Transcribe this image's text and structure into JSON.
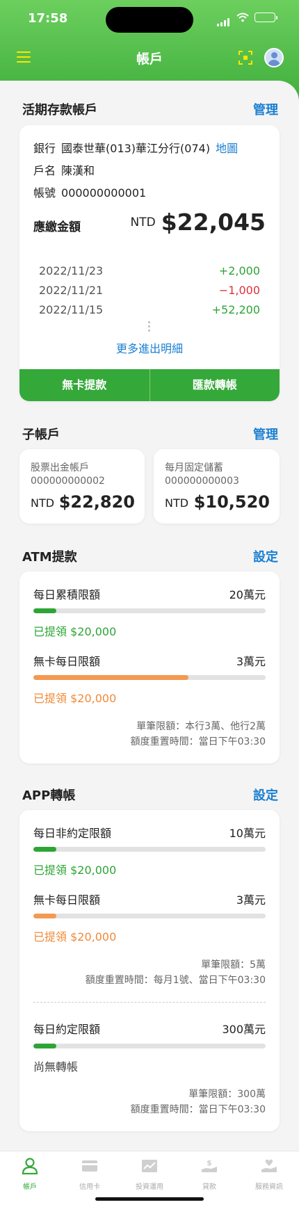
{
  "status_bar": {
    "time": "17:58"
  },
  "nav": {
    "title": "帳戶"
  },
  "savings": {
    "section_title": "活期存款帳戶",
    "manage": "管理",
    "bank_label": "銀行",
    "bank_value": "國泰世華(013)華江分行(074)",
    "map_link": "地圖",
    "name_label": "戶名",
    "name_value": "陳漢和",
    "account_label": "帳號",
    "account_value": "000000000001",
    "amount_label": "應繳金額",
    "currency": "NTD",
    "amount": "$22,045",
    "transactions": [
      {
        "date": "2022/11/23",
        "amount": "+2,000"
      },
      {
        "date": "2022/11/21",
        "amount": "−1,000"
      },
      {
        "date": "2022/11/15",
        "amount": "+52,200"
      }
    ],
    "more_link": "更多進出明細",
    "btn_cardless": "無卡提款",
    "btn_transfer": "匯款轉帳"
  },
  "sub_accounts": {
    "section_title": "子帳戶",
    "manage": "管理",
    "items": [
      {
        "label": "股票出金帳戶",
        "account": "000000000002",
        "currency": "NTD",
        "amount": "$22,820"
      },
      {
        "label": "每月固定儲蓄",
        "account": "000000000003",
        "currency": "NTD",
        "amount": "$10,520"
      }
    ]
  },
  "atm": {
    "section_title": "ATM提款",
    "settings": "設定",
    "limits": [
      {
        "name": "每日累積限額",
        "value": "20萬元",
        "used": "已提領 $20,000",
        "progress": 0.1,
        "color": "#2ca536"
      },
      {
        "name": "無卡每日限額",
        "value": "3萬元",
        "used": "已提領 $20,000",
        "progress": 0.667,
        "color": "#f39a52"
      }
    ],
    "note1": "單筆限額：本行3萬、他行2萬",
    "note2": "額度重置時間：當日下午03:30"
  },
  "app_transfer": {
    "section_title": "APP轉帳",
    "settings": "設定",
    "limits": [
      {
        "name": "每日非約定限額",
        "value": "10萬元",
        "used": "已提領 $20,000",
        "progress": 0.1,
        "color": "#2ca536"
      },
      {
        "name": "無卡每日限額",
        "value": "3萬元",
        "used": "已提領 $20,000",
        "progress": 0.1,
        "color": "#f39a52"
      },
      {
        "name": "每日約定限額",
        "value": "300萬元",
        "used": "尚無轉帳",
        "progress": 0.1,
        "color": "#2ca536"
      }
    ],
    "note1": "單筆限額：5萬",
    "note2": "額度重置時間：每月1號、當日下午03:30",
    "note3": "單筆限額：300萬",
    "note4": "額度重置時間：當日下午03:30"
  },
  "tabbar": {
    "items": [
      {
        "label": "帳戶",
        "icon": "user-icon"
      },
      {
        "label": "信用卡",
        "icon": "credit-card-icon"
      },
      {
        "label": "投資運用",
        "icon": "chart-icon"
      },
      {
        "label": "貸款",
        "icon": "loan-icon"
      },
      {
        "label": "服務資訊",
        "icon": "service-icon"
      }
    ]
  }
}
